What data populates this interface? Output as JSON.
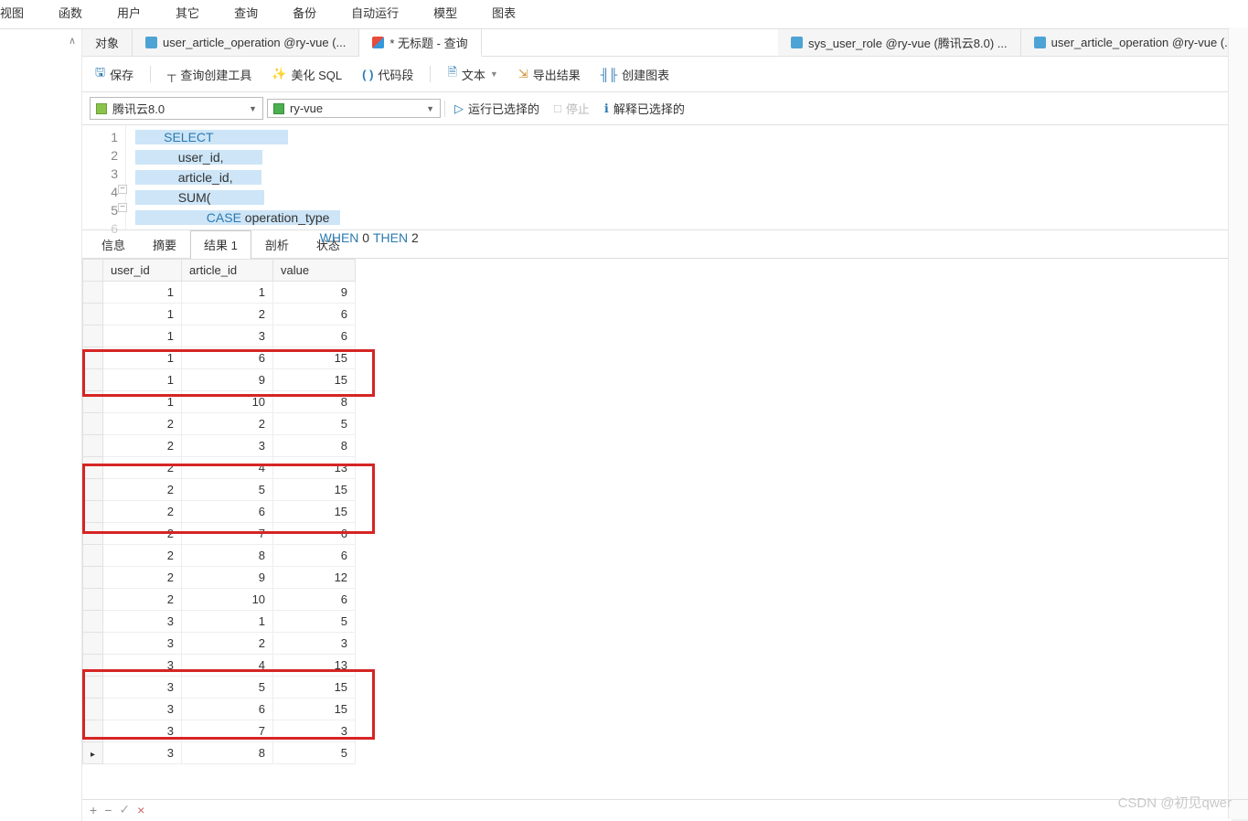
{
  "menubar": [
    "视图",
    "函数",
    "用户",
    "其它",
    "查询",
    "备份",
    "自动运行",
    "模型",
    "图表"
  ],
  "tabs": {
    "objects": "对象",
    "t1": "user_article_operation @ry-vue (...",
    "t2": "* 无标题 - 查询",
    "t3": "sys_user_role @ry-vue (腾讯云8.0) ...",
    "t4": "user_article_operation @ry-vue (..."
  },
  "toolbar": {
    "save": "保存",
    "builder": "查询创建工具",
    "beautify": "美化 SQL",
    "snippet": "代码段",
    "text": "文本",
    "export": "导出结果",
    "chart": "创建图表"
  },
  "conn": {
    "server": "腾讯云8.0",
    "db": "ry-vue",
    "run": "运行已选择的",
    "stop": "停止",
    "explain": "解释已选择的"
  },
  "sql": {
    "l1a": "SELECT",
    "l2": "user_id,",
    "l3": "article_id,",
    "l4": "SUM(",
    "l5a": "CASE",
    "l5b": " operation_type",
    "l6a": "WHEN",
    "l6b": " 0 ",
    "l6c": "THEN",
    "l6d": " 2"
  },
  "result_tabs": [
    "信息",
    "摘要",
    "结果 1",
    "剖析",
    "状态"
  ],
  "columns": [
    "user_id",
    "article_id",
    "value"
  ],
  "rows": [
    [
      1,
      1,
      9
    ],
    [
      1,
      2,
      6
    ],
    [
      1,
      3,
      6
    ],
    [
      1,
      6,
      15
    ],
    [
      1,
      9,
      15
    ],
    [
      1,
      10,
      8
    ],
    [
      2,
      2,
      5
    ],
    [
      2,
      3,
      8
    ],
    [
      2,
      4,
      13
    ],
    [
      2,
      5,
      15
    ],
    [
      2,
      6,
      15
    ],
    [
      2,
      7,
      6
    ],
    [
      2,
      8,
      6
    ],
    [
      2,
      9,
      12
    ],
    [
      2,
      10,
      6
    ],
    [
      3,
      1,
      5
    ],
    [
      3,
      2,
      3
    ],
    [
      3,
      4,
      13
    ],
    [
      3,
      5,
      15
    ],
    [
      3,
      6,
      15
    ],
    [
      3,
      7,
      3
    ],
    [
      3,
      8,
      5
    ]
  ],
  "highlight_groups": [
    [
      3,
      4
    ],
    [
      8,
      9,
      10
    ],
    [
      17,
      18,
      19
    ]
  ],
  "pointer_row": 21,
  "statusbar_icons": [
    "+",
    "−",
    "✓",
    "×"
  ],
  "watermark": "CSDN @初见qwer"
}
